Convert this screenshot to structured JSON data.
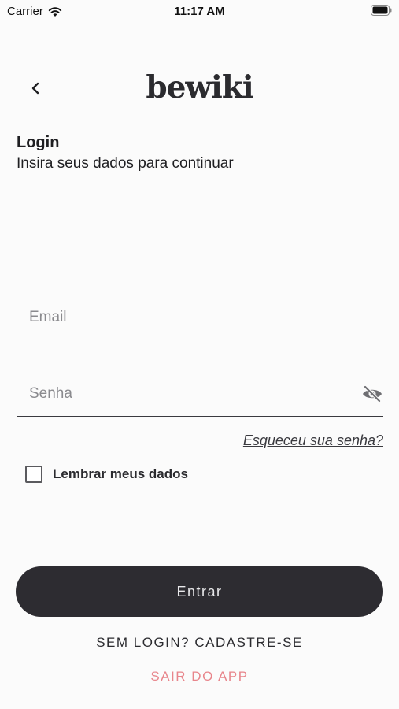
{
  "status_bar": {
    "carrier": "Carrier",
    "time": "11:17 AM"
  },
  "header": {
    "logo": "bewiki"
  },
  "login": {
    "title": "Login",
    "subtitle": "Insira seus dados para continuar",
    "email_placeholder": "Email",
    "email_value": "",
    "password_placeholder": "Senha",
    "password_value": "",
    "forgot_password": "Esqueceu sua senha?",
    "remember_label": "Lembrar meus dados",
    "remember_checked": false,
    "submit_label": "Entrar",
    "signup_label": "SEM LOGIN? CADASTRE-SE",
    "exit_label": "SAIR DO APP"
  },
  "colors": {
    "background": "#fbfbfb",
    "button": "#2d2c31",
    "exit_text": "#e8858b"
  },
  "icons": {
    "back": "chevron-left-icon",
    "toggle_password": "eye-off-icon",
    "wifi": "wifi-icon",
    "battery": "battery-icon"
  }
}
